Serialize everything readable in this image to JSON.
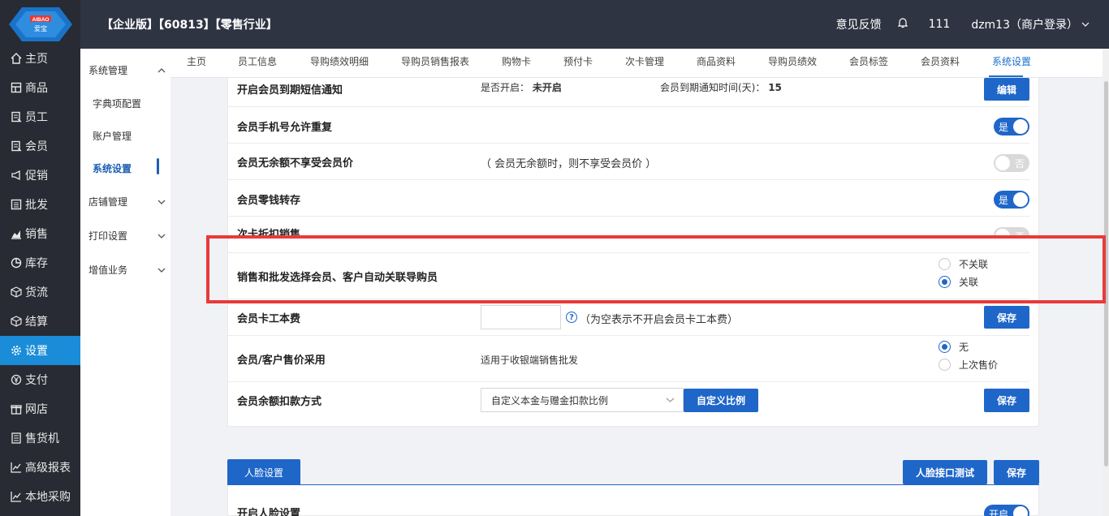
{
  "header": {
    "title": "【企业版】【60813】【零售行业】",
    "feedback": "意见反馈",
    "count": "111",
    "user": "dzm13（商户登录）"
  },
  "logo": {
    "top_text": "AIBAO",
    "bottom_text": "爱宝"
  },
  "leftnav": {
    "items": [
      {
        "label": "主页",
        "icon": "home-icon"
      },
      {
        "label": "商品",
        "icon": "box-icon"
      },
      {
        "label": "员工",
        "icon": "id-card-icon"
      },
      {
        "label": "会员",
        "icon": "member-icon"
      },
      {
        "label": "促销",
        "icon": "megaphone-icon"
      },
      {
        "label": "批发",
        "icon": "list-icon"
      },
      {
        "label": "销售",
        "icon": "chart-icon"
      },
      {
        "label": "库存",
        "icon": "pie-icon"
      },
      {
        "label": "货流",
        "icon": "cube-icon"
      },
      {
        "label": "结算",
        "icon": "cube-icon"
      },
      {
        "label": "设置",
        "icon": "gear-icon"
      },
      {
        "label": "支付",
        "icon": "yen-icon"
      },
      {
        "label": "网店",
        "icon": "gift-icon"
      },
      {
        "label": "售货机",
        "icon": "machine-icon"
      },
      {
        "label": "高级报表",
        "icon": "trend-icon"
      },
      {
        "label": "本地采购",
        "icon": "trend-icon"
      }
    ],
    "active": "设置"
  },
  "subnav": {
    "group1": "系统管理",
    "children": [
      "字典项配置",
      "账户管理",
      "系统设置"
    ],
    "group2": "店铺管理",
    "group3": "打印设置",
    "group4": "增值业务"
  },
  "tabs": [
    "主页",
    "员工信息",
    "导购绩效明细",
    "导购员销售报表",
    "购物卡",
    "预付卡",
    "次卡管理",
    "商品资料",
    "导购员绩效",
    "会员标签",
    "会员资料",
    "系统设置"
  ],
  "settings": {
    "expire_sms": {
      "label": "开启会员到期短信通知",
      "enabled_label": "是否开启：",
      "enabled_value": "未开启",
      "days_label": "会员到期通知时间(天)：",
      "days_value": "15",
      "button": "编辑"
    },
    "phone_dup": {
      "label": "会员手机号允许重复",
      "toggle": "是"
    },
    "no_balance": {
      "label": "会员无余额不享受会员价",
      "note": "（ 会员无余额时，则不享受会员价 ）",
      "toggle": "否"
    },
    "change_transfer": {
      "label": "会员零钱转存",
      "toggle": "是"
    },
    "card_discount": {
      "label": "次卡折扣销售",
      "toggle": "否"
    },
    "auto_link": {
      "label": "销售和批发选择会员、客户自动关联导购员",
      "opt1": "不关联",
      "opt2": "关联"
    },
    "card_fee": {
      "label": "会员卡工本费",
      "help": "?",
      "note": "（为空表示不开启会员卡工本费）",
      "button": "保存"
    },
    "price_mode": {
      "label": "会员/客户售价采用",
      "note": "适用于收银端销售批发",
      "opt1": "无",
      "opt2": "上次售价"
    },
    "deduct_mode": {
      "label": "会员余额扣款方式",
      "select": "自定义本金与赠金扣款比例",
      "custom_button": "自定义比例",
      "button": "保存"
    }
  },
  "face": {
    "tab": "人脸设置",
    "test_button": "人脸接口测试",
    "save_button": "保存",
    "enable_label": "开启人脸设置",
    "toggle": "开启"
  }
}
